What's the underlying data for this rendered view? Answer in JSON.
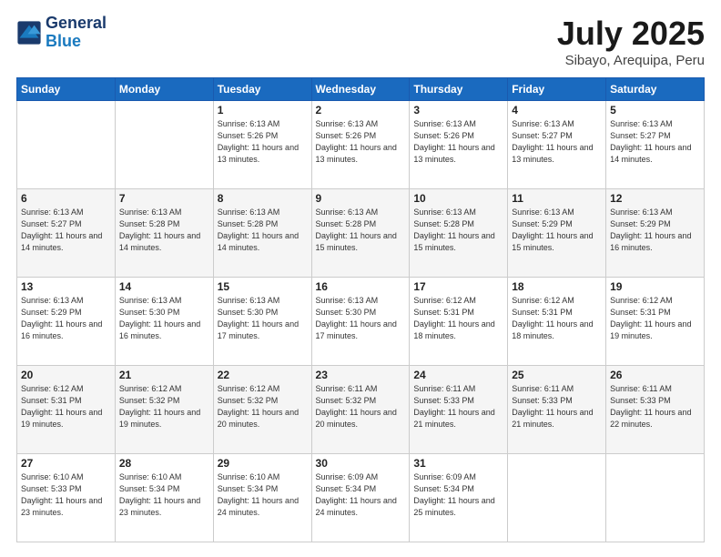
{
  "logo": {
    "line1": "General",
    "line2": "Blue"
  },
  "title": "July 2025",
  "subtitle": "Sibayo, Arequipa, Peru",
  "weekdays": [
    "Sunday",
    "Monday",
    "Tuesday",
    "Wednesday",
    "Thursday",
    "Friday",
    "Saturday"
  ],
  "weeks": [
    [
      {
        "day": "",
        "info": ""
      },
      {
        "day": "",
        "info": ""
      },
      {
        "day": "1",
        "info": "Sunrise: 6:13 AM\nSunset: 5:26 PM\nDaylight: 11 hours and 13 minutes."
      },
      {
        "day": "2",
        "info": "Sunrise: 6:13 AM\nSunset: 5:26 PM\nDaylight: 11 hours and 13 minutes."
      },
      {
        "day": "3",
        "info": "Sunrise: 6:13 AM\nSunset: 5:26 PM\nDaylight: 11 hours and 13 minutes."
      },
      {
        "day": "4",
        "info": "Sunrise: 6:13 AM\nSunset: 5:27 PM\nDaylight: 11 hours and 13 minutes."
      },
      {
        "day": "5",
        "info": "Sunrise: 6:13 AM\nSunset: 5:27 PM\nDaylight: 11 hours and 14 minutes."
      }
    ],
    [
      {
        "day": "6",
        "info": "Sunrise: 6:13 AM\nSunset: 5:27 PM\nDaylight: 11 hours and 14 minutes."
      },
      {
        "day": "7",
        "info": "Sunrise: 6:13 AM\nSunset: 5:28 PM\nDaylight: 11 hours and 14 minutes."
      },
      {
        "day": "8",
        "info": "Sunrise: 6:13 AM\nSunset: 5:28 PM\nDaylight: 11 hours and 14 minutes."
      },
      {
        "day": "9",
        "info": "Sunrise: 6:13 AM\nSunset: 5:28 PM\nDaylight: 11 hours and 15 minutes."
      },
      {
        "day": "10",
        "info": "Sunrise: 6:13 AM\nSunset: 5:28 PM\nDaylight: 11 hours and 15 minutes."
      },
      {
        "day": "11",
        "info": "Sunrise: 6:13 AM\nSunset: 5:29 PM\nDaylight: 11 hours and 15 minutes."
      },
      {
        "day": "12",
        "info": "Sunrise: 6:13 AM\nSunset: 5:29 PM\nDaylight: 11 hours and 16 minutes."
      }
    ],
    [
      {
        "day": "13",
        "info": "Sunrise: 6:13 AM\nSunset: 5:29 PM\nDaylight: 11 hours and 16 minutes."
      },
      {
        "day": "14",
        "info": "Sunrise: 6:13 AM\nSunset: 5:30 PM\nDaylight: 11 hours and 16 minutes."
      },
      {
        "day": "15",
        "info": "Sunrise: 6:13 AM\nSunset: 5:30 PM\nDaylight: 11 hours and 17 minutes."
      },
      {
        "day": "16",
        "info": "Sunrise: 6:13 AM\nSunset: 5:30 PM\nDaylight: 11 hours and 17 minutes."
      },
      {
        "day": "17",
        "info": "Sunrise: 6:12 AM\nSunset: 5:31 PM\nDaylight: 11 hours and 18 minutes."
      },
      {
        "day": "18",
        "info": "Sunrise: 6:12 AM\nSunset: 5:31 PM\nDaylight: 11 hours and 18 minutes."
      },
      {
        "day": "19",
        "info": "Sunrise: 6:12 AM\nSunset: 5:31 PM\nDaylight: 11 hours and 19 minutes."
      }
    ],
    [
      {
        "day": "20",
        "info": "Sunrise: 6:12 AM\nSunset: 5:31 PM\nDaylight: 11 hours and 19 minutes."
      },
      {
        "day": "21",
        "info": "Sunrise: 6:12 AM\nSunset: 5:32 PM\nDaylight: 11 hours and 19 minutes."
      },
      {
        "day": "22",
        "info": "Sunrise: 6:12 AM\nSunset: 5:32 PM\nDaylight: 11 hours and 20 minutes."
      },
      {
        "day": "23",
        "info": "Sunrise: 6:11 AM\nSunset: 5:32 PM\nDaylight: 11 hours and 20 minutes."
      },
      {
        "day": "24",
        "info": "Sunrise: 6:11 AM\nSunset: 5:33 PM\nDaylight: 11 hours and 21 minutes."
      },
      {
        "day": "25",
        "info": "Sunrise: 6:11 AM\nSunset: 5:33 PM\nDaylight: 11 hours and 21 minutes."
      },
      {
        "day": "26",
        "info": "Sunrise: 6:11 AM\nSunset: 5:33 PM\nDaylight: 11 hours and 22 minutes."
      }
    ],
    [
      {
        "day": "27",
        "info": "Sunrise: 6:10 AM\nSunset: 5:33 PM\nDaylight: 11 hours and 23 minutes."
      },
      {
        "day": "28",
        "info": "Sunrise: 6:10 AM\nSunset: 5:34 PM\nDaylight: 11 hours and 23 minutes."
      },
      {
        "day": "29",
        "info": "Sunrise: 6:10 AM\nSunset: 5:34 PM\nDaylight: 11 hours and 24 minutes."
      },
      {
        "day": "30",
        "info": "Sunrise: 6:09 AM\nSunset: 5:34 PM\nDaylight: 11 hours and 24 minutes."
      },
      {
        "day": "31",
        "info": "Sunrise: 6:09 AM\nSunset: 5:34 PM\nDaylight: 11 hours and 25 minutes."
      },
      {
        "day": "",
        "info": ""
      },
      {
        "day": "",
        "info": ""
      }
    ]
  ]
}
